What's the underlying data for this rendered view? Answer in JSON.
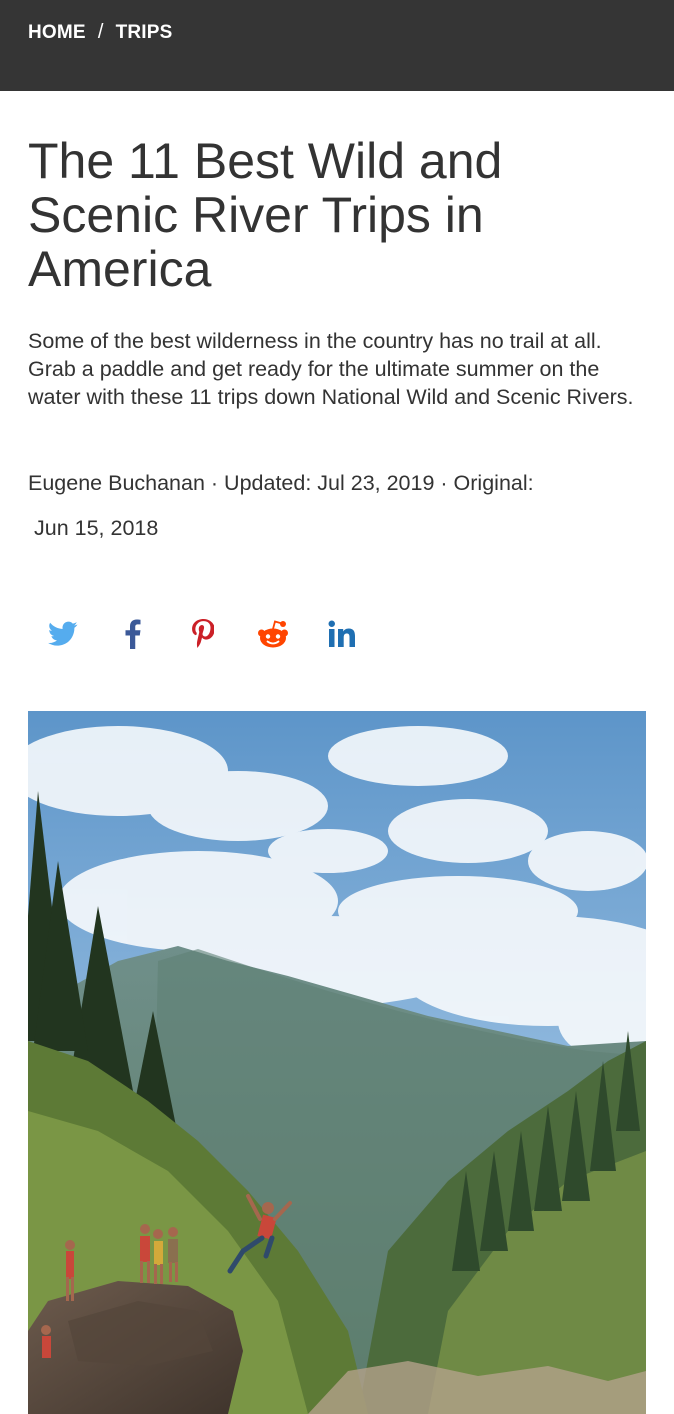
{
  "nav": {
    "breadcrumb": {
      "home": "HOME",
      "separator": "/",
      "trips": "TRIPS"
    }
  },
  "article": {
    "title": "The 11 Best Wild and Scenic River Trips in America",
    "dek": "Some of the best wilderness in the country has no trail at all. Grab a paddle and get ready for the ultimate summer on the water with these 11 trips down National Wild and Scenic Rivers.",
    "byline": {
      "author": "Eugene Buchanan",
      "dot1": " · ",
      "updated_label": "Updated: ",
      "updated_date": "Jul 23, 2019",
      "dot2": " · ",
      "original_label": "Original:",
      "original_date": "Jun 15, 2018"
    }
  },
  "share": [
    {
      "icon": "twitter-icon",
      "color": "#55acee"
    },
    {
      "icon": "facebook-icon",
      "color": "#3b5998"
    },
    {
      "icon": "pinterest-icon",
      "color": "#cb2027"
    },
    {
      "icon": "reddit-icon",
      "color": "#ff4500"
    },
    {
      "icon": "linkedin-icon",
      "color": "#1f6fb2"
    }
  ],
  "colors": {
    "topbar": "#353535",
    "text": "#333333"
  }
}
